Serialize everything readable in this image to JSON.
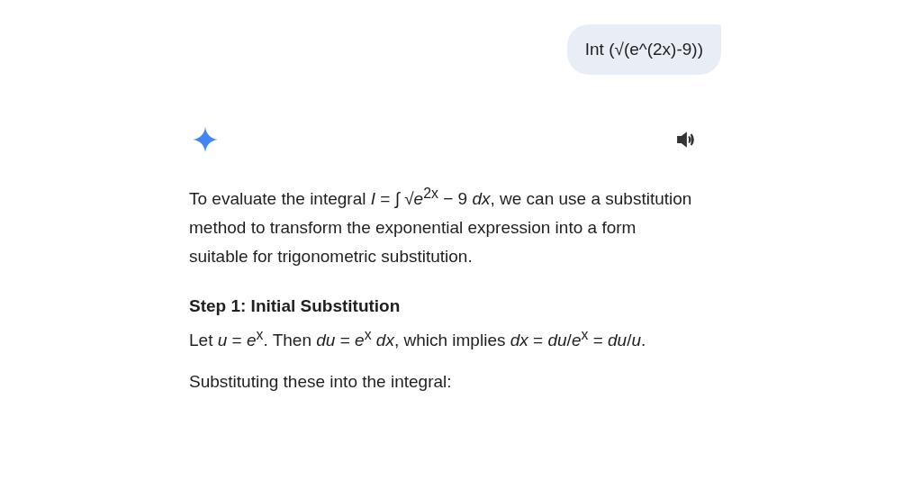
{
  "user_message": "Int (√(e^(2x)-9))",
  "response": {
    "paragraphs": [
      {
        "kind": "text",
        "text": "To evaluate the integral *I* = ∫ √*e*$^{2x}$ − 9 *dx*, we can use a substitution method to transform the exponential expression into a form suitable for trigonometric substitution."
      },
      {
        "kind": "heading",
        "text": "Step 1: Initial Substitution"
      },
      {
        "kind": "text",
        "text": "Let *u* = *e*$^{x}$. Then *du* = *e*$^{x}$ *dx*, which implies *dx* = *du*/*e*$^{x}$ = *du*/*u*."
      },
      {
        "kind": "text",
        "text": "Substituting these into the integral:"
      }
    ]
  }
}
